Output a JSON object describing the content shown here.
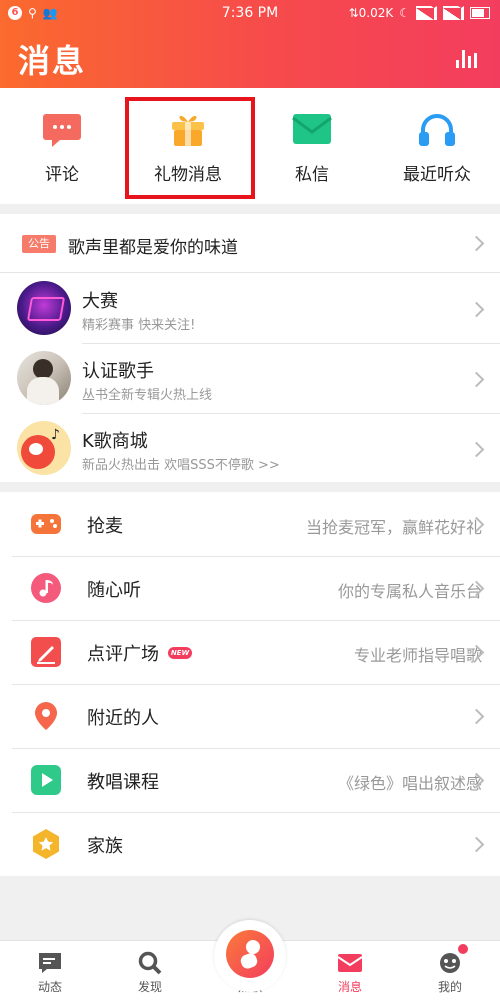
{
  "status_bar": {
    "time": "7:36 PM",
    "network_speed": "0.02K",
    "left_badge": "6"
  },
  "header": {
    "title": "消息",
    "stats_icon": "bar-chart-icon"
  },
  "quick_actions": [
    {
      "label": "评论",
      "icon": "comment-bubble-icon"
    },
    {
      "label": "礼物消息",
      "icon": "gift-box-icon"
    },
    {
      "label": "私信",
      "icon": "envelope-icon"
    },
    {
      "label": "最近听众",
      "icon": "headphones-icon"
    }
  ],
  "notice": {
    "badge": "公告",
    "text": "歌声里都是爱你的味道"
  },
  "feeds": [
    {
      "title": "大赛",
      "subtitle": "精彩赛事 快来关注!",
      "avatar": "contest-avatar"
    },
    {
      "title": "认证歌手",
      "subtitle": "丛书全新专辑火热上线",
      "avatar": "singer-avatar"
    },
    {
      "title": "K歌商城",
      "subtitle": "新品火热出击 欢唱SSS不停歌 >>",
      "avatar": "mall-avatar"
    }
  ],
  "features": [
    {
      "label": "抢麦",
      "right": "当抢麦冠军，赢鲜花好礼",
      "icon": "gamepad-icon",
      "color": "#f5743a"
    },
    {
      "label": "随心听",
      "right": "你的专属私人音乐台",
      "icon": "music-note-icon",
      "color": "#f45a7c"
    },
    {
      "label": "点评广场",
      "right": "专业老师指导唱歌",
      "icon": "pen-icon",
      "color": "#f34e4e",
      "badge": "NEW"
    },
    {
      "label": "附近的人",
      "right": "",
      "icon": "location-pin-icon",
      "color": "#f5664d"
    },
    {
      "label": "教唱课程",
      "right": "《绿色》唱出叙述感",
      "icon": "play-icon",
      "color": "#2fc98a"
    },
    {
      "label": "家族",
      "right": "",
      "icon": "family-star-icon",
      "color": "#f5b52a"
    }
  ],
  "bottom_nav": [
    {
      "label": "动态",
      "icon": "feed-icon"
    },
    {
      "label": "发现",
      "icon": "search-icon"
    },
    {
      "label": "点歌",
      "icon": "sing-icon"
    },
    {
      "label": "消息",
      "icon": "message-icon",
      "active": true
    },
    {
      "label": "我的",
      "icon": "profile-icon"
    }
  ],
  "colors": {
    "accent": "#f33d5e",
    "header_start": "#fb6a2e",
    "highlight_box": "#e8141c"
  }
}
